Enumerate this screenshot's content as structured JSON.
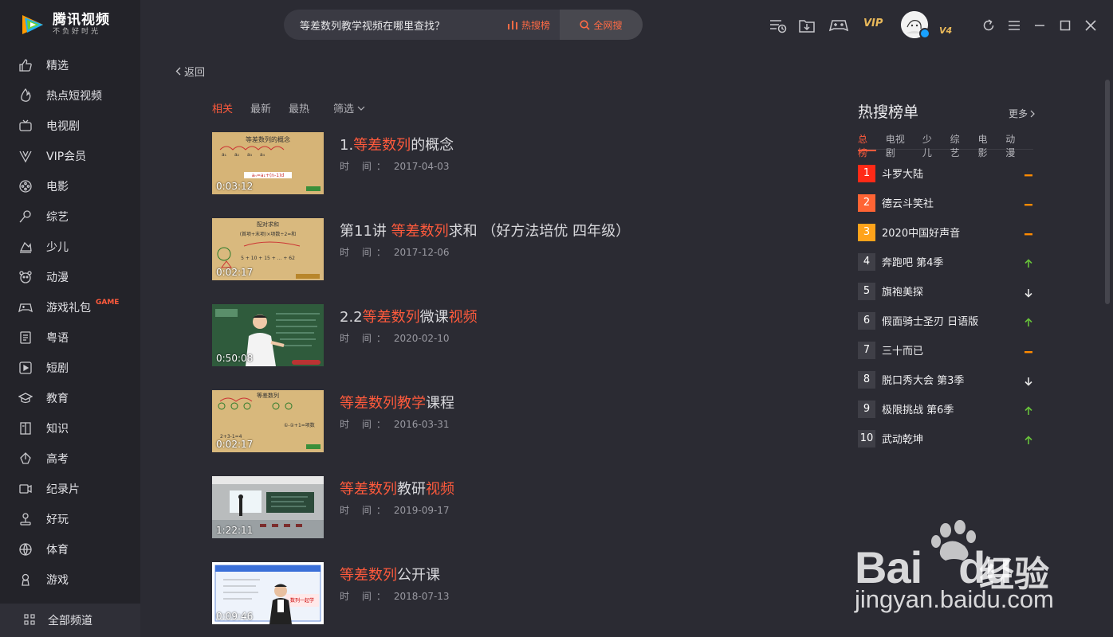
{
  "app": {
    "name": "腾讯视频",
    "slogan": "不负好时光"
  },
  "sidebar": {
    "items": [
      {
        "label": "精选",
        "icon": "thumbs-up-icon"
      },
      {
        "label": "热点短视频",
        "icon": "flame-icon"
      },
      {
        "label": "电视剧",
        "icon": "tv-icon"
      },
      {
        "label": "VIP会员",
        "icon": "vip-v-icon"
      },
      {
        "label": "电影",
        "icon": "film-reel-icon"
      },
      {
        "label": "综艺",
        "icon": "microphone-icon"
      },
      {
        "label": "少儿",
        "icon": "kids-icon"
      },
      {
        "label": "动漫",
        "icon": "bear-face-icon"
      },
      {
        "label": "游戏礼包",
        "icon": "gamepad-icon",
        "tag": "GAME"
      },
      {
        "label": "粤语",
        "icon": "book-icon"
      },
      {
        "label": "短剧",
        "icon": "play-square-icon"
      },
      {
        "label": "教育",
        "icon": "graduation-cap-icon"
      },
      {
        "label": "知识",
        "icon": "open-book-icon"
      },
      {
        "label": "高考",
        "icon": "pen-nib-icon"
      },
      {
        "label": "纪录片",
        "icon": "camera-icon"
      },
      {
        "label": "好玩",
        "icon": "joystick-icon"
      },
      {
        "label": "体育",
        "icon": "basketball-icon"
      },
      {
        "label": "游戏",
        "icon": "game-icon"
      }
    ],
    "all_channels": "全部频道"
  },
  "search": {
    "value": "等差数列教学视频在哪里查找？",
    "hot_label": "热搜榜",
    "web_search_label": "全网搜"
  },
  "header": {
    "vip_badge": "VIP",
    "vip_level": "V4"
  },
  "main": {
    "back_label": "返回",
    "sort_tabs": [
      "相关",
      "最新",
      "最热"
    ],
    "filter_label": "筛选",
    "date_label": "时  间：",
    "results": [
      {
        "prefix": "1.",
        "hl": "等差数列",
        "suffix": "的概念",
        "suffix_hl": "",
        "date": "2017-04-03",
        "duration": "0:03:12"
      },
      {
        "prefix": "第11讲 ",
        "hl": "等差数列",
        "suffix": "求和 （好方法培优 四年级）",
        "suffix_hl": "",
        "date": "2017-12-06",
        "duration": "0:02:17"
      },
      {
        "prefix": "2.2",
        "hl": "等差数列",
        "suffix": "微课",
        "suffix_hl": "视频",
        "date": "2020-02-10",
        "duration": "0:50:08"
      },
      {
        "prefix": "",
        "hl": "等差数列教学",
        "suffix": "课程",
        "suffix_hl": "",
        "date": "2016-03-31",
        "duration": "0:02:17"
      },
      {
        "prefix": "",
        "hl": "等差数列",
        "suffix": "教研",
        "suffix_hl": "视频",
        "date": "2019-09-17",
        "duration": "1:22:11"
      },
      {
        "prefix": "",
        "hl": "等差数列",
        "suffix": "公开课",
        "suffix_hl": "",
        "date": "2018-07-13",
        "duration": "0:09:46"
      }
    ]
  },
  "hot": {
    "title": "热搜榜单",
    "more_label": "更多",
    "tabs": [
      "总榜",
      "电视剧",
      "少儿",
      "综艺",
      "电影",
      "动漫"
    ],
    "items": [
      {
        "rank": "1",
        "name": "斗罗大陆",
        "trend": "flat"
      },
      {
        "rank": "2",
        "name": "德云斗笑社",
        "trend": "flat"
      },
      {
        "rank": "3",
        "name": "2020中国好声音",
        "trend": "flat"
      },
      {
        "rank": "4",
        "name": "奔跑吧 第4季",
        "trend": "up"
      },
      {
        "rank": "5",
        "name": "旗袍美探",
        "trend": "down"
      },
      {
        "rank": "6",
        "name": "假面骑士圣刃 日语版",
        "trend": "up"
      },
      {
        "rank": "7",
        "name": "三十而已",
        "trend": "flat"
      },
      {
        "rank": "8",
        "name": "脱口秀大会 第3季",
        "trend": "down"
      },
      {
        "rank": "9",
        "name": "极限挑战 第6季",
        "trend": "up"
      },
      {
        "rank": "10",
        "name": "武动乾坤",
        "trend": "up"
      }
    ],
    "colors": {
      "rank1": "#ff2a17",
      "rank2": "#ff6434",
      "rank3": "#ffa31b",
      "up": "#67c23a",
      "flat": "#ff8a00",
      "down": "#e6e6e6"
    }
  },
  "watermark": {
    "brand": "Bai",
    "brand2": "du",
    "cn": "经验",
    "url": "jingyan.baidu.com"
  },
  "theme": {
    "accent": "#ff5a3c",
    "background": "#2b2b33",
    "sidebar": "#232329"
  }
}
